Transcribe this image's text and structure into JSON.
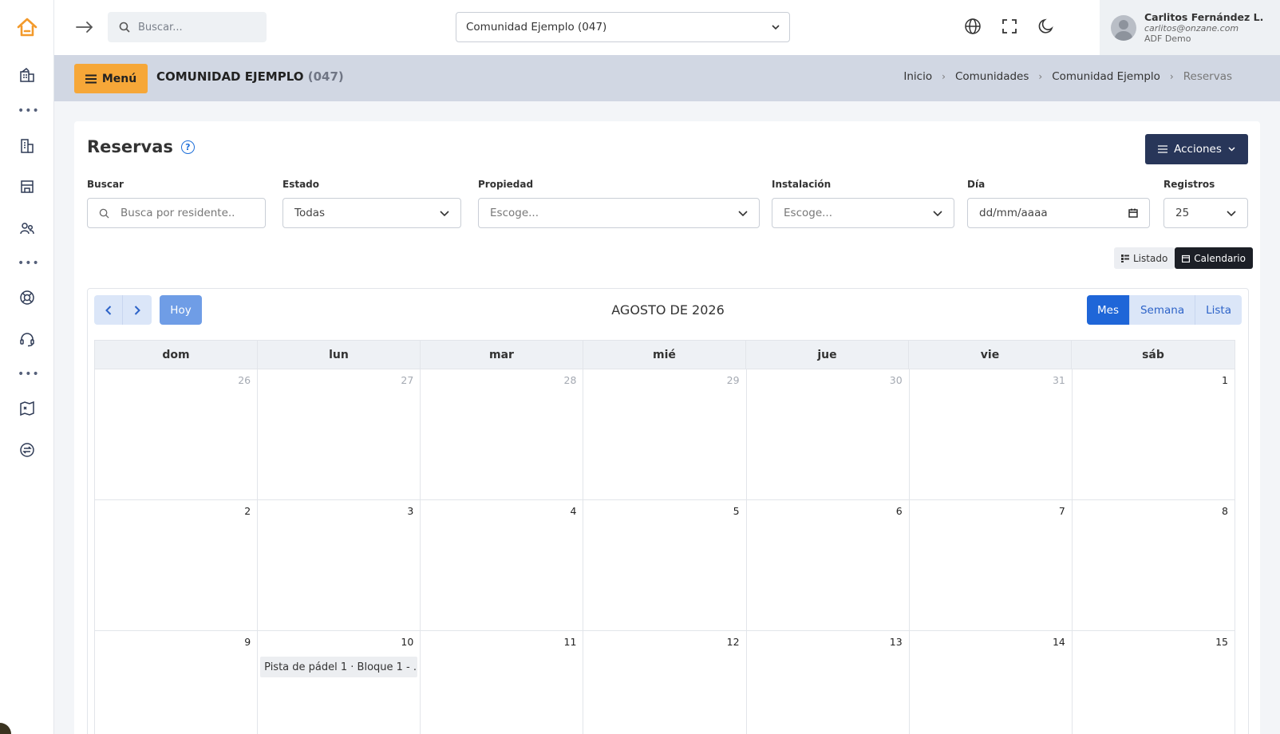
{
  "topbar": {
    "search_placeholder": "Buscar...",
    "community_selected": "Comunidad Ejemplo (047)"
  },
  "user": {
    "name": "Carlitos Fernández L.",
    "email": "carlitos@onzane.com",
    "role": "ADF Demo"
  },
  "header": {
    "menu_label": "Menú",
    "title_main": "COMUNIDAD EJEMPLO",
    "title_code": "(047)",
    "breadcrumb": [
      "Inicio",
      "Comunidades",
      "Comunidad Ejemplo",
      "Reservas"
    ]
  },
  "page": {
    "title": "Reservas",
    "help_glyph": "?",
    "actions_label": "Acciones"
  },
  "filters": {
    "buscar": {
      "label": "Buscar",
      "placeholder": "Busca por residente.."
    },
    "estado": {
      "label": "Estado",
      "value": "Todas"
    },
    "propiedad": {
      "label": "Propiedad",
      "placeholder": "Escoge..."
    },
    "instalacion": {
      "label": "Instalación",
      "placeholder": "Escoge..."
    },
    "dia": {
      "label": "Día",
      "placeholder": "dd/mm/aaaa"
    },
    "registros": {
      "label": "Registros",
      "value": "25"
    }
  },
  "view_toggle": {
    "list": "Listado",
    "calendar": "Calendario",
    "active": "Calendario"
  },
  "calendar": {
    "today_label": "Hoy",
    "month_title": "AGOSTO DE 2026",
    "views": [
      "Mes",
      "Semana",
      "Lista"
    ],
    "active_view": "Mes",
    "weekdays": [
      "dom",
      "lun",
      "mar",
      "mié",
      "jue",
      "vie",
      "sáb"
    ],
    "weeks": [
      [
        {
          "day": "26",
          "other": true
        },
        {
          "day": "27",
          "other": true
        },
        {
          "day": "28",
          "other": true
        },
        {
          "day": "29",
          "other": true
        },
        {
          "day": "30",
          "other": true
        },
        {
          "day": "31",
          "other": true
        },
        {
          "day": "1",
          "other": false
        }
      ],
      [
        {
          "day": "2"
        },
        {
          "day": "3"
        },
        {
          "day": "4"
        },
        {
          "day": "5"
        },
        {
          "day": "6"
        },
        {
          "day": "7"
        },
        {
          "day": "8"
        }
      ],
      [
        {
          "day": "9"
        },
        {
          "day": "10",
          "event": "Pista de pádel 1 · Bloque 1 - ..."
        },
        {
          "day": "11"
        },
        {
          "day": "12"
        },
        {
          "day": "13"
        },
        {
          "day": "14"
        },
        {
          "day": "15"
        }
      ]
    ]
  },
  "colors": {
    "accent_orange": "#f6a738",
    "primary_blue": "#1f66d8",
    "navy": "#283659",
    "header_strip": "#d1d7e3"
  },
  "sidebar_icons": [
    "home-icon",
    "building-icon",
    "office-icon",
    "store-icon",
    "users-icon",
    "lifebuoy-icon",
    "headset-icon",
    "map-icon",
    "exchange-icon"
  ]
}
